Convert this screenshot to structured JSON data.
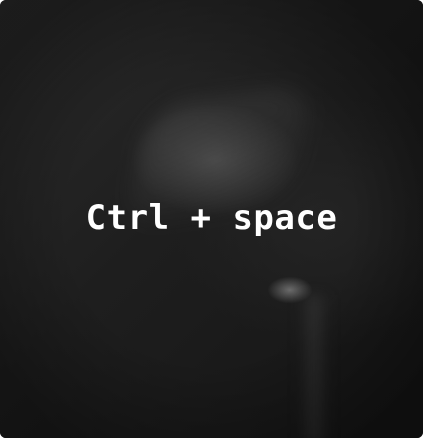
{
  "overlay": {
    "shortcut_text": "Ctrl + space"
  },
  "background": {
    "image": "blurred-lamp-photo",
    "dominant_color": "#1e1e1e",
    "text_color": "#ffffff"
  }
}
